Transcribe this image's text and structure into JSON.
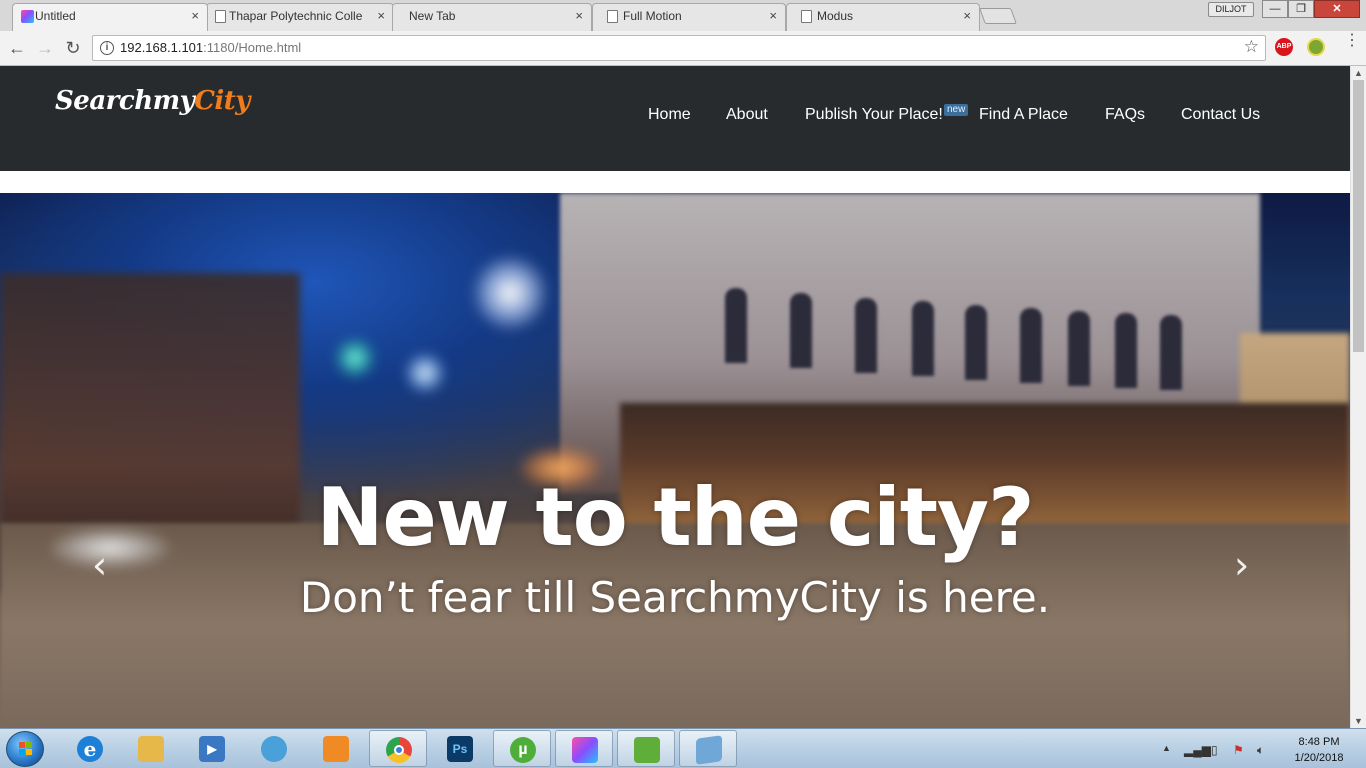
{
  "browser": {
    "tabs": [
      {
        "title": "Untitled",
        "active": true
      },
      {
        "title": "Thapar Polytechnic Colle",
        "active": false
      },
      {
        "title": "New Tab",
        "active": false
      },
      {
        "title": "Full Motion",
        "active": false
      },
      {
        "title": "Modus",
        "active": false
      }
    ],
    "close_glyph": "×",
    "user_badge": "DILJOT",
    "window_controls": {
      "minimize": "—",
      "maximize": "❐",
      "close": "✕"
    },
    "nav": {
      "back": "←",
      "forward": "→",
      "reload": "↻"
    },
    "url_host": "192.168.1.101",
    "url_rest": ":1180/Home.html",
    "extensions": [
      {
        "name": "adblock-plus",
        "label": "ABP",
        "color": "#d9141b"
      },
      {
        "name": "extension-2",
        "label": "",
        "color": "#7aa832"
      }
    ]
  },
  "site": {
    "logo_part1": "Searchmy",
    "logo_part2": "City",
    "nav": [
      "Home",
      "About",
      "Publish Your Place!",
      "Find A Place",
      "FAQs",
      "Contact Us"
    ],
    "new_badge": "new",
    "hero_title": "New to the city?",
    "hero_subtitle": "Don’t fear till SearchmyCity is here.",
    "prev_arrow": "‹",
    "next_arrow": "›"
  },
  "taskbar": {
    "apps": [
      {
        "name": "internet-explorer",
        "label": "e",
        "color": "#1e7fd6",
        "open": false
      },
      {
        "name": "file-explorer",
        "label": "",
        "color": "#e6b84a",
        "open": false
      },
      {
        "name": "media-player",
        "label": "▶",
        "color": "#3a78c4",
        "open": false
      },
      {
        "name": "people",
        "label": "",
        "color": "#4aa0d8",
        "open": false
      },
      {
        "name": "uc-browser",
        "label": "",
        "color": "#f08a24",
        "open": false
      },
      {
        "name": "chrome",
        "label": "",
        "color": "#e8453c",
        "open": true
      },
      {
        "name": "photoshop",
        "label": "Ps",
        "color": "#0b3a66",
        "open": false
      },
      {
        "name": "utorrent",
        "label": "µ",
        "color": "#4fae3a",
        "open": true
      },
      {
        "name": "app-gradient",
        "label": "",
        "color": "#8a4dff",
        "open": true
      },
      {
        "name": "spreadsheet-app",
        "label": "",
        "color": "#5fae3a",
        "open": true
      },
      {
        "name": "notepad",
        "label": "",
        "color": "#6fa8d6",
        "open": true
      }
    ],
    "clock_time": "8:48 PM",
    "clock_date": "1/20/2018"
  }
}
